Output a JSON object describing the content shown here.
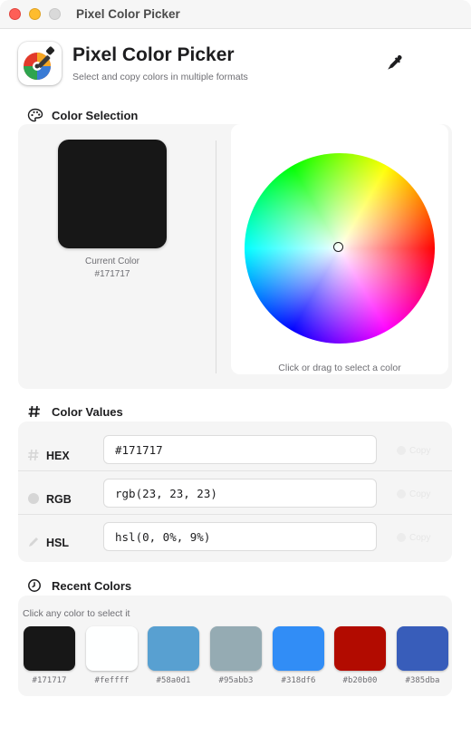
{
  "window": {
    "title": "Pixel Color Picker"
  },
  "header": {
    "title": "Pixel Color Picker",
    "subtitle": "Select and copy colors in multiple formats"
  },
  "sections": {
    "selection": "Color Selection",
    "values": "Color Values",
    "recent": "Recent Colors"
  },
  "current": {
    "label": "Current Color",
    "hex": "#171717",
    "color": "#171717"
  },
  "wheel": {
    "hint": "Click or drag to select a color"
  },
  "values": [
    {
      "name": "HEX",
      "value": "#171717",
      "copy_label": "Copy",
      "icon": "hash-icon"
    },
    {
      "name": "RGB",
      "value": "rgb(23, 23, 23)",
      "copy_label": "Copy",
      "icon": "circle-icon"
    },
    {
      "name": "HSL",
      "value": "hsl(0, 0%, 9%)",
      "copy_label": "Copy",
      "icon": "pencil-icon"
    }
  ],
  "recent": {
    "hint": "Click any color to select it",
    "colors": [
      "#171717",
      "#feffff",
      "#58a0d1",
      "#95abb3",
      "#318df6",
      "#b20b00",
      "#385dba"
    ]
  }
}
